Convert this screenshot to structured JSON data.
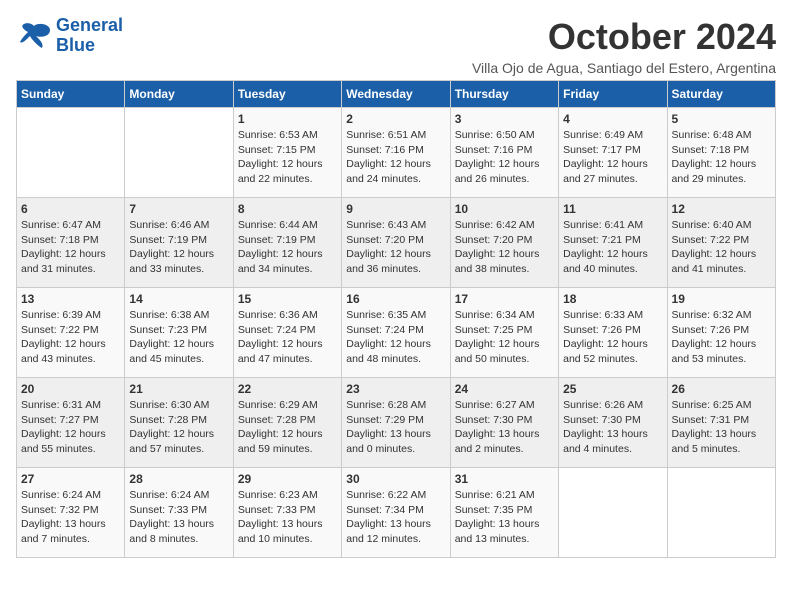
{
  "logo": {
    "line1": "General",
    "line2": "Blue"
  },
  "title": "October 2024",
  "subtitle": "Villa Ojo de Agua, Santiago del Estero, Argentina",
  "days_of_week": [
    "Sunday",
    "Monday",
    "Tuesday",
    "Wednesday",
    "Thursday",
    "Friday",
    "Saturday"
  ],
  "weeks": [
    [
      {
        "day": "",
        "info": ""
      },
      {
        "day": "",
        "info": ""
      },
      {
        "day": "1",
        "info": "Sunrise: 6:53 AM\nSunset: 7:15 PM\nDaylight: 12 hours and 22 minutes."
      },
      {
        "day": "2",
        "info": "Sunrise: 6:51 AM\nSunset: 7:16 PM\nDaylight: 12 hours and 24 minutes."
      },
      {
        "day": "3",
        "info": "Sunrise: 6:50 AM\nSunset: 7:16 PM\nDaylight: 12 hours and 26 minutes."
      },
      {
        "day": "4",
        "info": "Sunrise: 6:49 AM\nSunset: 7:17 PM\nDaylight: 12 hours and 27 minutes."
      },
      {
        "day": "5",
        "info": "Sunrise: 6:48 AM\nSunset: 7:18 PM\nDaylight: 12 hours and 29 minutes."
      }
    ],
    [
      {
        "day": "6",
        "info": "Sunrise: 6:47 AM\nSunset: 7:18 PM\nDaylight: 12 hours and 31 minutes."
      },
      {
        "day": "7",
        "info": "Sunrise: 6:46 AM\nSunset: 7:19 PM\nDaylight: 12 hours and 33 minutes."
      },
      {
        "day": "8",
        "info": "Sunrise: 6:44 AM\nSunset: 7:19 PM\nDaylight: 12 hours and 34 minutes."
      },
      {
        "day": "9",
        "info": "Sunrise: 6:43 AM\nSunset: 7:20 PM\nDaylight: 12 hours and 36 minutes."
      },
      {
        "day": "10",
        "info": "Sunrise: 6:42 AM\nSunset: 7:20 PM\nDaylight: 12 hours and 38 minutes."
      },
      {
        "day": "11",
        "info": "Sunrise: 6:41 AM\nSunset: 7:21 PM\nDaylight: 12 hours and 40 minutes."
      },
      {
        "day": "12",
        "info": "Sunrise: 6:40 AM\nSunset: 7:22 PM\nDaylight: 12 hours and 41 minutes."
      }
    ],
    [
      {
        "day": "13",
        "info": "Sunrise: 6:39 AM\nSunset: 7:22 PM\nDaylight: 12 hours and 43 minutes."
      },
      {
        "day": "14",
        "info": "Sunrise: 6:38 AM\nSunset: 7:23 PM\nDaylight: 12 hours and 45 minutes."
      },
      {
        "day": "15",
        "info": "Sunrise: 6:36 AM\nSunset: 7:24 PM\nDaylight: 12 hours and 47 minutes."
      },
      {
        "day": "16",
        "info": "Sunrise: 6:35 AM\nSunset: 7:24 PM\nDaylight: 12 hours and 48 minutes."
      },
      {
        "day": "17",
        "info": "Sunrise: 6:34 AM\nSunset: 7:25 PM\nDaylight: 12 hours and 50 minutes."
      },
      {
        "day": "18",
        "info": "Sunrise: 6:33 AM\nSunset: 7:26 PM\nDaylight: 12 hours and 52 minutes."
      },
      {
        "day": "19",
        "info": "Sunrise: 6:32 AM\nSunset: 7:26 PM\nDaylight: 12 hours and 53 minutes."
      }
    ],
    [
      {
        "day": "20",
        "info": "Sunrise: 6:31 AM\nSunset: 7:27 PM\nDaylight: 12 hours and 55 minutes."
      },
      {
        "day": "21",
        "info": "Sunrise: 6:30 AM\nSunset: 7:28 PM\nDaylight: 12 hours and 57 minutes."
      },
      {
        "day": "22",
        "info": "Sunrise: 6:29 AM\nSunset: 7:28 PM\nDaylight: 12 hours and 59 minutes."
      },
      {
        "day": "23",
        "info": "Sunrise: 6:28 AM\nSunset: 7:29 PM\nDaylight: 13 hours and 0 minutes."
      },
      {
        "day": "24",
        "info": "Sunrise: 6:27 AM\nSunset: 7:30 PM\nDaylight: 13 hours and 2 minutes."
      },
      {
        "day": "25",
        "info": "Sunrise: 6:26 AM\nSunset: 7:30 PM\nDaylight: 13 hours and 4 minutes."
      },
      {
        "day": "26",
        "info": "Sunrise: 6:25 AM\nSunset: 7:31 PM\nDaylight: 13 hours and 5 minutes."
      }
    ],
    [
      {
        "day": "27",
        "info": "Sunrise: 6:24 AM\nSunset: 7:32 PM\nDaylight: 13 hours and 7 minutes."
      },
      {
        "day": "28",
        "info": "Sunrise: 6:24 AM\nSunset: 7:33 PM\nDaylight: 13 hours and 8 minutes."
      },
      {
        "day": "29",
        "info": "Sunrise: 6:23 AM\nSunset: 7:33 PM\nDaylight: 13 hours and 10 minutes."
      },
      {
        "day": "30",
        "info": "Sunrise: 6:22 AM\nSunset: 7:34 PM\nDaylight: 13 hours and 12 minutes."
      },
      {
        "day": "31",
        "info": "Sunrise: 6:21 AM\nSunset: 7:35 PM\nDaylight: 13 hours and 13 minutes."
      },
      {
        "day": "",
        "info": ""
      },
      {
        "day": "",
        "info": ""
      }
    ]
  ]
}
